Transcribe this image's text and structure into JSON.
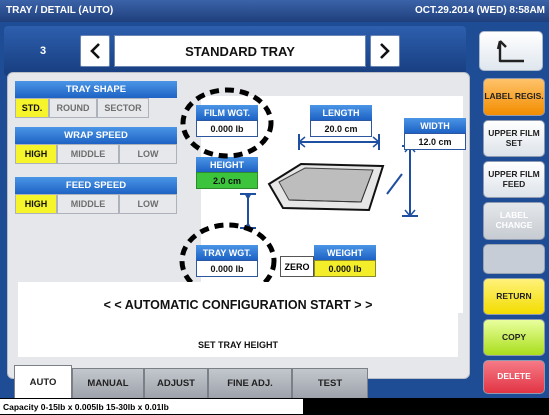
{
  "window": {
    "title": "TRAY / DETAIL (AUTO)",
    "datetime": "OCT.29.2014 (WED)  8:58AM"
  },
  "nav": {
    "number": "3",
    "title": "STANDARD TRAY"
  },
  "tray_shape": {
    "label": "TRAY SHAPE",
    "options": [
      "STD.",
      "ROUND",
      "SECTOR"
    ],
    "selected": "STD."
  },
  "wrap_speed": {
    "label": "WRAP SPEED",
    "options": [
      "HIGH",
      "MIDDLE",
      "LOW"
    ],
    "selected": "HIGH"
  },
  "feed_speed": {
    "label": "FEED SPEED",
    "options": [
      "HIGH",
      "MIDDLE",
      "LOW"
    ],
    "selected": "HIGH"
  },
  "fields": {
    "film_wgt": {
      "label": "FILM WGT.",
      "value": "0.000 lb"
    },
    "length": {
      "label": "LENGTH",
      "value": "20.0 cm"
    },
    "width": {
      "label": "WIDTH",
      "value": "12.0 cm"
    },
    "height": {
      "label": "HEIGHT",
      "value": "2.0 cm"
    },
    "tray_wgt": {
      "label": "TRAY WGT.",
      "value": "0.000 lb"
    },
    "weight": {
      "label": "WEIGHT",
      "value": "0.000 lb"
    }
  },
  "zero_label": "ZERO",
  "message": {
    "line1": "< < AUTOMATIC CONFIGURATION START > >",
    "line2": "SET TRAY HEIGHT"
  },
  "tabs": [
    {
      "label": "AUTO",
      "active": true
    },
    {
      "label": "MANUAL",
      "active": false
    },
    {
      "label": "ADJUST",
      "active": false
    },
    {
      "label": "FINE ADJ.",
      "active": false
    },
    {
      "label": "TEST",
      "active": false
    }
  ],
  "side_buttons": {
    "label_regis": "LABEL REGIS.",
    "upper_film_set": "UPPER FILM SET",
    "upper_film_feed": "UPPER FILM FEED",
    "label_change": "LABEL CHANGE",
    "return": "RETURN",
    "copy": "COPY",
    "delete": "DELETE"
  },
  "footer": "Capacity 0-15lb x 0.005lb  15-30lb x 0.01lb",
  "colors": {
    "accent_blue": "#1e62c4",
    "selected_yellow": "#f6f42a",
    "height_green": "#3cc43c"
  }
}
